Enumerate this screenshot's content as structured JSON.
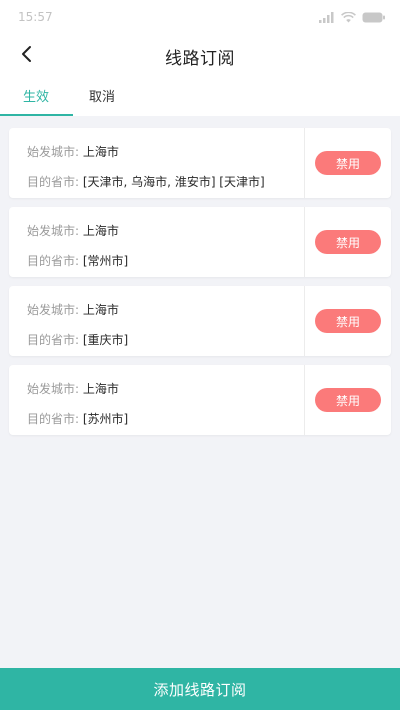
{
  "status_bar": {
    "time": "15:57",
    "icons": [
      "signal-icon",
      "wifi-icon",
      "battery-icon"
    ]
  },
  "header": {
    "back_icon": "chevron-left-icon",
    "title": "线路订阅"
  },
  "tabs": [
    {
      "label": "生效",
      "active": true
    },
    {
      "label": "取消",
      "active": false
    }
  ],
  "subscriptions": [
    {
      "origin_label": "始发城市:",
      "origin_value": "上海市",
      "dest_label": "目的省市:",
      "dest_value": "[天津市, 乌海市, 淮安市] [天津市]",
      "action_label": "禁用"
    },
    {
      "origin_label": "始发城市:",
      "origin_value": "上海市",
      "dest_label": "目的省市:",
      "dest_value": "[常州市]",
      "action_label": "禁用"
    },
    {
      "origin_label": "始发城市:",
      "origin_value": "上海市",
      "dest_label": "目的省市:",
      "dest_value": "[重庆市]",
      "action_label": "禁用"
    },
    {
      "origin_label": "始发城市:",
      "origin_value": "上海市",
      "dest_label": "目的省市:",
      "dest_value": "[苏州市]",
      "action_label": "禁用"
    }
  ],
  "footer": {
    "add_button_label": "添加线路订阅"
  },
  "colors": {
    "accent": "#2fb5a4",
    "danger": "#fb7a7a",
    "background": "#f2f3f7"
  }
}
